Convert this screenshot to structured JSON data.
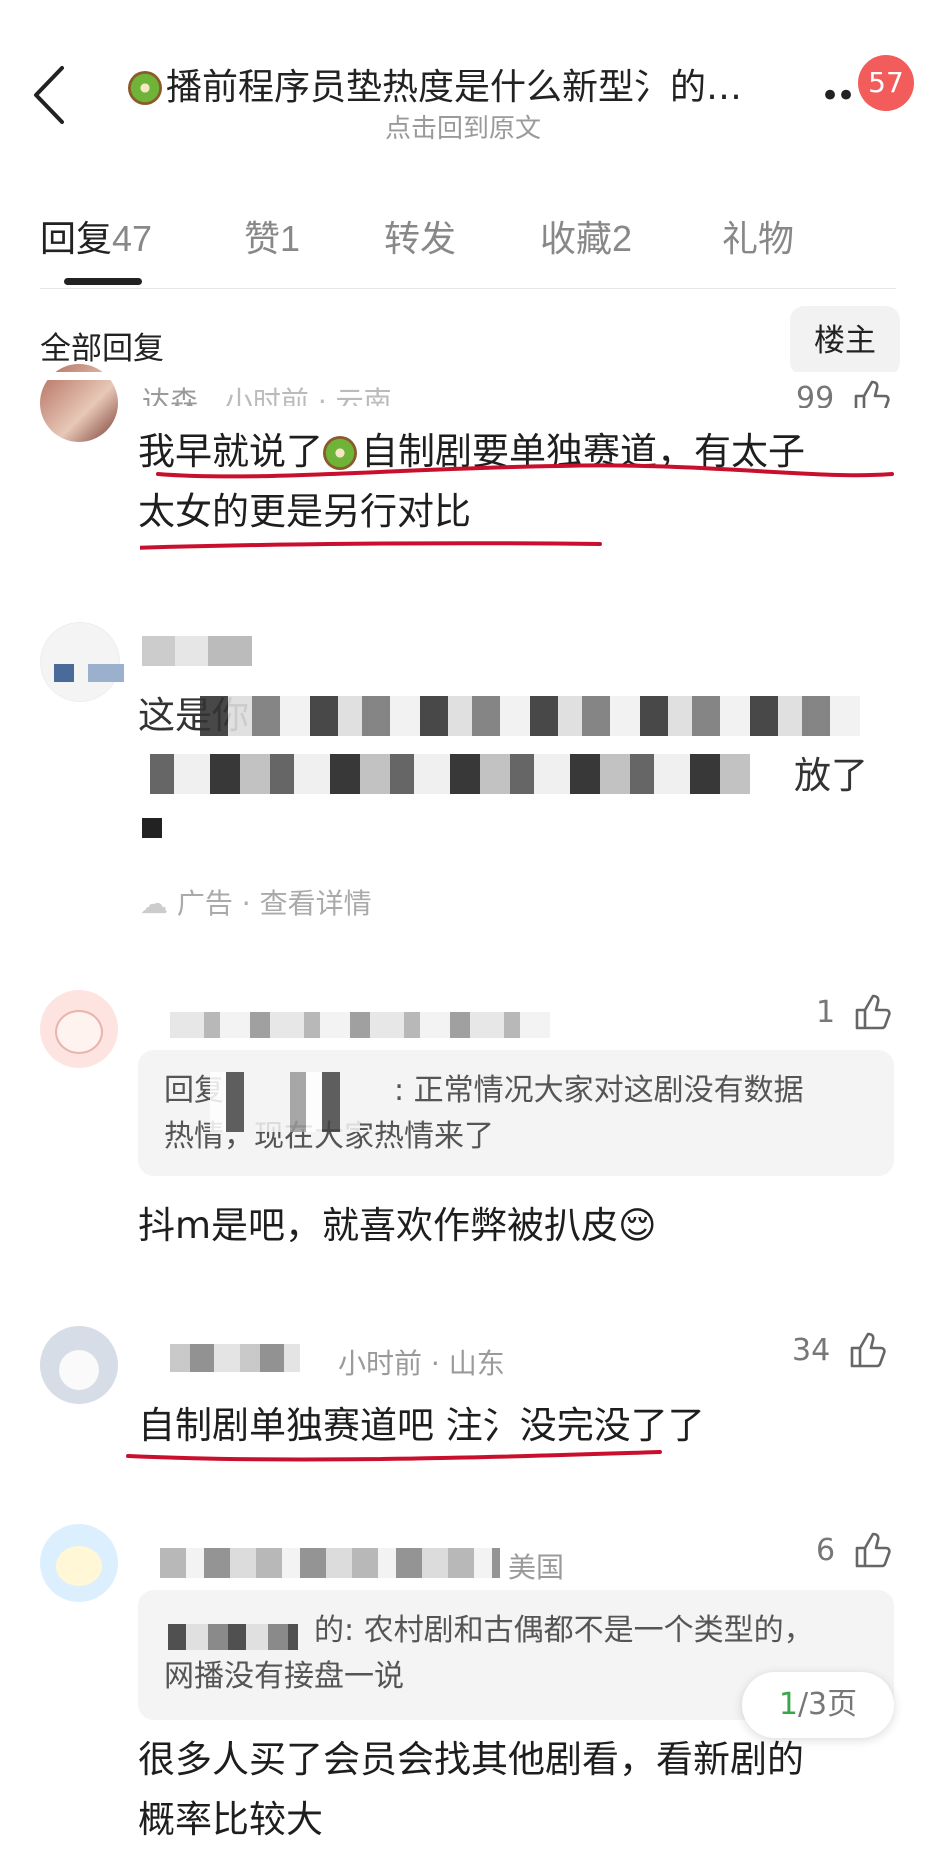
{
  "header": {
    "title": "播前程序员垫热度是什么新型氵的…",
    "subtitle": "点击回到原文",
    "notification_count": "57"
  },
  "tabs": [
    {
      "label": "回复",
      "count": "47"
    },
    {
      "label": "赞",
      "count": "1"
    },
    {
      "label": "转发",
      "count": ""
    },
    {
      "label": "收藏",
      "count": "2"
    },
    {
      "label": "礼物",
      "count": ""
    }
  ],
  "filter": {
    "label": "全部回复",
    "owner_button": "楼主"
  },
  "comments": [
    {
      "name": "达森",
      "meta": "小时前 · 云南",
      "likes": "99",
      "text_line1": "我早就说了",
      "text_line1b": "自制剧要单独赛道，有太子",
      "text_line2": "太女的更是另行对比"
    },
    {
      "ad_line1": "这是你",
      "ad_line2": "放了",
      "ad_footer": "广告 · 查看详情"
    },
    {
      "likes": "1",
      "quote_prefix": "回复",
      "quote": ": 正常情况大家对这剧没有数据",
      "quote_line2": "热情，现在大家热情来了",
      "text": "抖m是吧，就喜欢作弊被扒皮😌"
    },
    {
      "meta": "小时前 · 山东",
      "likes": "34",
      "text": "自制剧单独赛道吧 注氵没完没了了"
    },
    {
      "meta": "美国",
      "likes": "6",
      "quote": "的: 农村剧和古偶都不是一个类型的，",
      "quote_line2": "网播没有接盘一说",
      "text_line1": "很多人买了会员会找其他剧看，看新剧的",
      "text_line2": "概率比较大"
    }
  ],
  "pagination": {
    "current": "1",
    "total": "/3页"
  },
  "colors": {
    "accent_red": "#f25c5a",
    "annotation_red": "#c8102e",
    "page_green": "#3aa64a"
  }
}
